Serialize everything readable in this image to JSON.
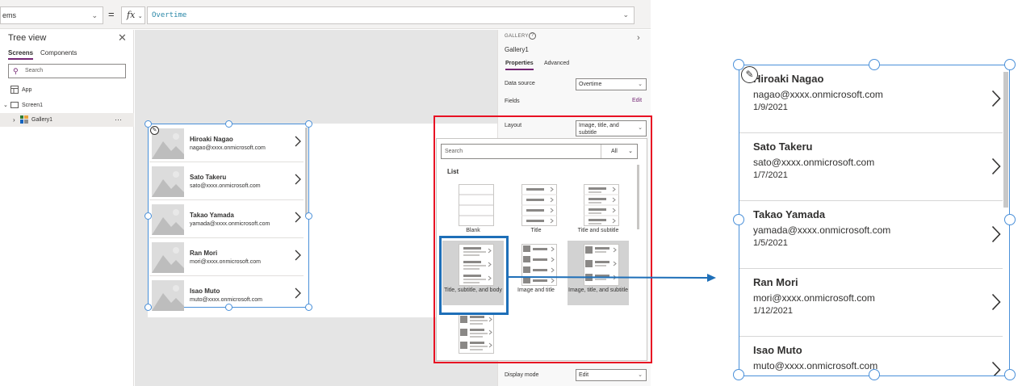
{
  "formula_bar": {
    "property": "ems",
    "equals": "=",
    "fx_label": "fx",
    "formula": "Overtime"
  },
  "tree_view": {
    "title": "Tree view",
    "tabs": [
      "Screens",
      "Components"
    ],
    "search_placeholder": "Search",
    "items": [
      {
        "label": "App"
      },
      {
        "label": "Screen1"
      },
      {
        "label": "Gallery1"
      }
    ],
    "more": "···"
  },
  "gallery_small": {
    "rows": [
      {
        "name": "Hiroaki Nagao",
        "email": "nagao@xxxx.onmicrosoft.com"
      },
      {
        "name": "Sato Takeru",
        "email": "sato@xxxx.onmicrosoft.com"
      },
      {
        "name": "Takao Yamada",
        "email": "yamada@xxxx.onmicrosoft.com"
      },
      {
        "name": "Ran Mori",
        "email": "mori@xxxx.onmicrosoft.com"
      },
      {
        "name": "Isao Muto",
        "email": "muto@xxxx.onmicrosoft.com"
      }
    ]
  },
  "properties": {
    "header": "GALLERY",
    "name": "Gallery1",
    "tabs": [
      "Properties",
      "Advanced"
    ],
    "data_source_label": "Data source",
    "data_source_value": "Overtime",
    "fields_label": "Fields",
    "fields_edit": "Edit",
    "layout_label": "Layout",
    "layout_value": "Image, title, and subtitle",
    "display_mode_label": "Display mode",
    "display_mode_value": "Edit"
  },
  "layout_picker": {
    "search_placeholder": "Search",
    "filter_value": "All",
    "section": "List",
    "tiles": [
      {
        "label": "Blank"
      },
      {
        "label": "Title"
      },
      {
        "label": "Title and subtitle"
      },
      {
        "label": "Title, subtitle, and body"
      },
      {
        "label": "Image and title"
      },
      {
        "label": "Image, title, and subtitle"
      }
    ]
  },
  "gallery_zoom": {
    "rows": [
      {
        "name": "Hiroaki Nagao",
        "email": "nagao@xxxx.onmicrosoft.com",
        "date": "1/9/2021"
      },
      {
        "name": "Sato Takeru",
        "email": "sato@xxxx.onmicrosoft.com",
        "date": "1/7/2021"
      },
      {
        "name": "Takao Yamada",
        "email": "yamada@xxxx.onmicrosoft.com",
        "date": "1/5/2021"
      },
      {
        "name": "Ran Mori",
        "email": "mori@xxxx.onmicrosoft.com",
        "date": "1/12/2021"
      },
      {
        "name": "Isao Muto",
        "email": "muto@xxxx.onmicrosoft.com",
        "date": ""
      }
    ]
  },
  "colors": {
    "accent": "#742774",
    "selection": "#4a90d9",
    "highlight_frame": "#e81123",
    "arrow": "#1e6fb8"
  }
}
